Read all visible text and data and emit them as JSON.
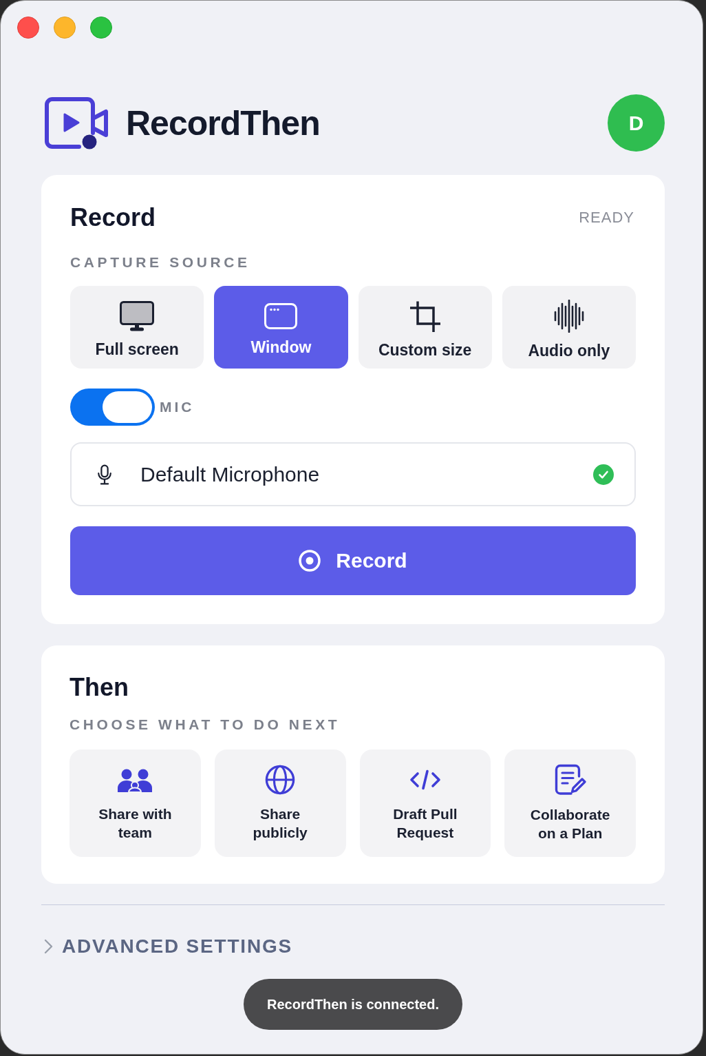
{
  "window": {
    "controls": [
      {
        "kind": "close"
      },
      {
        "kind": "minimize"
      },
      {
        "kind": "zoom"
      }
    ]
  },
  "header": {
    "app_name": "RecordThen",
    "avatar": {
      "initial": "D"
    }
  },
  "record": {
    "title": "Record",
    "status": "READY",
    "capture_source": {
      "label": "CAPTURE SOURCE",
      "options": [
        {
          "kind": "monitor",
          "label": "Full screen",
          "selected": false
        },
        {
          "kind": "window",
          "label": "Window",
          "selected": true
        },
        {
          "kind": "crop",
          "label": "Custom size",
          "selected": false
        },
        {
          "kind": "audio",
          "label": "Audio only",
          "selected": false
        }
      ]
    },
    "mic": {
      "label": "MIC",
      "on": true
    },
    "microphone": {
      "value": "Default Microphone",
      "verified": true
    },
    "record_button": {
      "label": "Record"
    }
  },
  "then": {
    "title": "Then",
    "subtitle": "CHOOSE WHAT TO DO NEXT",
    "actions": [
      {
        "kind": "team",
        "label": "Share with team"
      },
      {
        "kind": "globe",
        "label": "Share publicly"
      },
      {
        "kind": "code",
        "label": "Draft Pull Request"
      },
      {
        "kind": "document",
        "label": "Collaborate on a Plan"
      }
    ]
  },
  "advanced_settings": {
    "label": "ADVANCED SETTINGS",
    "expanded": false
  },
  "toast": {
    "message": "RecordThen is connected."
  }
}
